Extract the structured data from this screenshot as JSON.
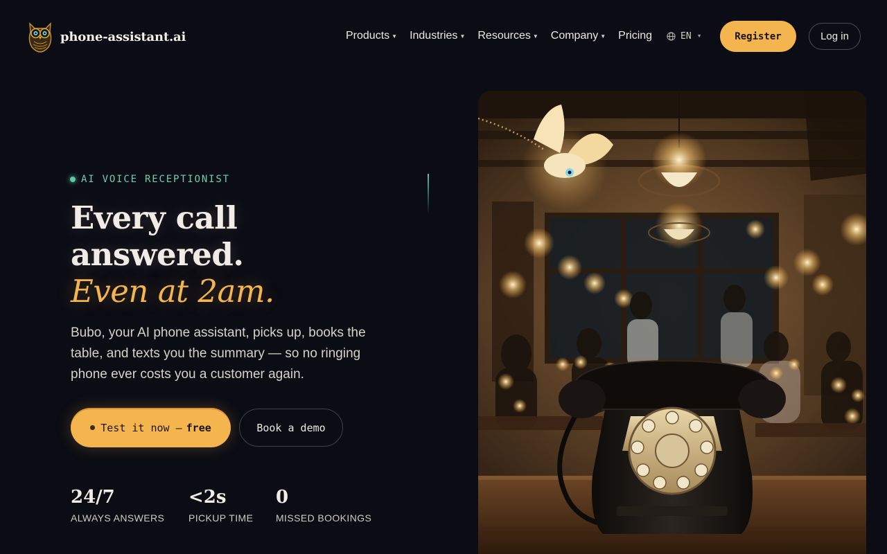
{
  "brand": {
    "name": "phone-assistant.ai",
    "logo_icon": "owl-logo-icon"
  },
  "nav": {
    "items": [
      {
        "label": "Products",
        "has_dropdown": true
      },
      {
        "label": "Industries",
        "has_dropdown": true
      },
      {
        "label": "Resources",
        "has_dropdown": true
      },
      {
        "label": "Company",
        "has_dropdown": true
      },
      {
        "label": "Pricing",
        "has_dropdown": false
      }
    ],
    "language": {
      "code": "EN",
      "icon": "globe-icon"
    },
    "register_label": "Register",
    "login_label": "Log in"
  },
  "hero": {
    "eyebrow": "AI VOICE RECEPTIONIST",
    "headline_line1": "Every call",
    "headline_line2": "answered.",
    "headline_emphasis": "Even at 2am.",
    "lede": "Bubo, your AI phone assistant, picks up, books the table, and texts you the summary — so no ringing phone ever costs you a customer again.",
    "cta_primary_prefix": "Test it now —",
    "cta_primary_emphasis": "free",
    "cta_secondary": "Book a demo",
    "stats": [
      {
        "value": "24/7",
        "label": "ALWAYS ANSWERS"
      },
      {
        "value": "<2s",
        "label": "PICKUP TIME"
      },
      {
        "value": "0",
        "label": "MISSED BOOKINGS"
      }
    ],
    "image": "restaurant-rotary-phone-with-glowing-owl-image"
  },
  "colors": {
    "background": "#0b0c14",
    "accent": "#f4b54f",
    "eyebrow_teal": "#6fd0ad",
    "text": "#ece9e3"
  }
}
